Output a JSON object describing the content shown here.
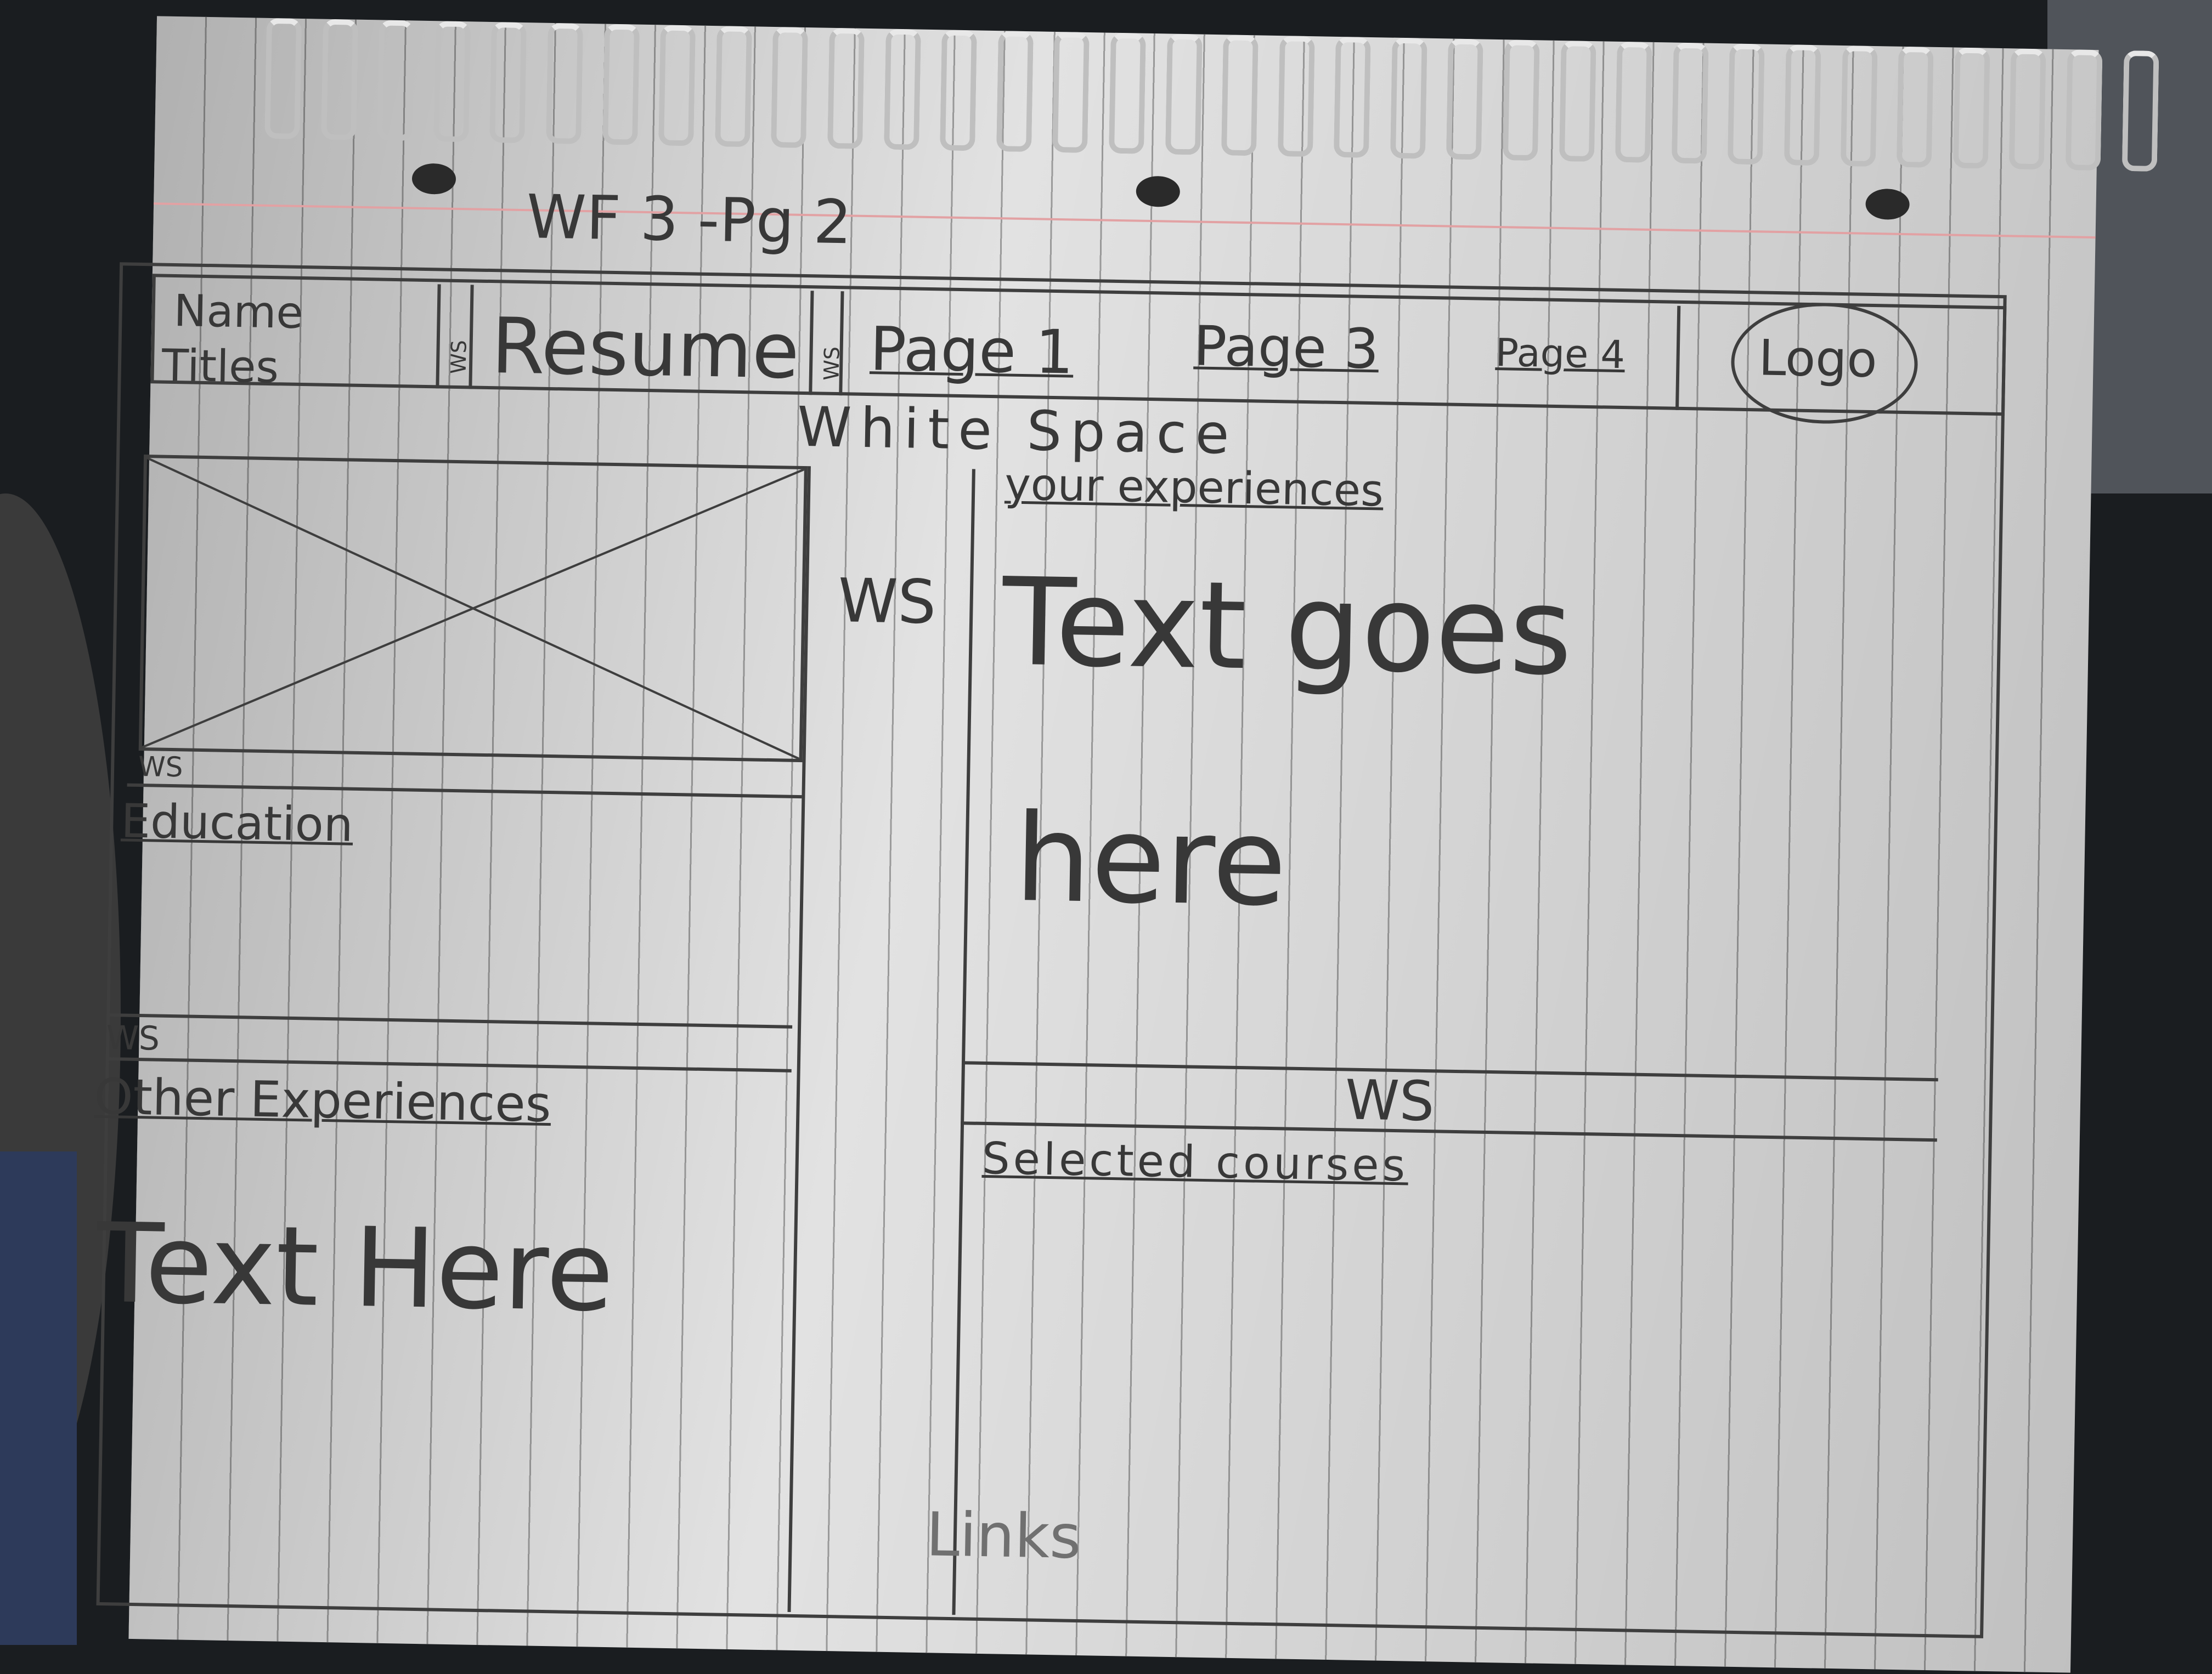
{
  "sheet_title": "WF 3 -Pg 2",
  "nav": {
    "name": "Name",
    "titles": "Titles",
    "ws_a": "WS",
    "resume": "Resume",
    "ws_b": "WS",
    "page1": "Page 1",
    "page3": "Page 3",
    "page4": "Page 4",
    "logo": "Logo"
  },
  "white_space_label": "White Space",
  "left": {
    "image_ws": "WS",
    "education": "Education",
    "ws": "WS",
    "other_experiences": "Other Experiences",
    "text_here": "Text Here"
  },
  "gutter_ws": "WS",
  "right": {
    "your_experiences": "your experiences",
    "text_goes": "Text goes",
    "here": "here",
    "ws": "WS",
    "selected_courses": "Selected courses"
  },
  "footer": {
    "links": "Links"
  },
  "colors": {
    "paper": "#e2e2e2",
    "pencil": "#3e3e3e",
    "margin": "#e2a1a3"
  }
}
